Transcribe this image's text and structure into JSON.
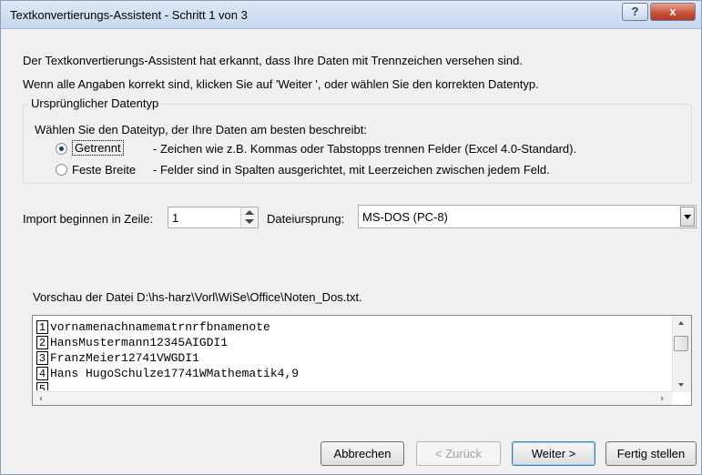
{
  "window": {
    "title": "Textkonvertierungs-Assistent - Schritt 1 von 3",
    "help_label": "?",
    "close_label": "x"
  },
  "intro": {
    "line1": "Der Textkonvertierungs-Assistent hat erkannt, dass Ihre Daten mit Trennzeichen versehen sind.",
    "line2": "Wenn alle Angaben korrekt sind, klicken Sie auf 'Weiter ', oder wählen Sie den korrekten Datentyp."
  },
  "datatype_group": {
    "title": "Ursprünglicher Datentyp",
    "prompt": "Wählen Sie den Dateityp, der Ihre Daten am besten beschreibt:",
    "options": [
      {
        "label": "Getrennt",
        "description": "- Zeichen wie z.B. Kommas oder Tabstopps trennen Felder (Excel 4.0-Standard).",
        "selected": true
      },
      {
        "label": "Feste Breite",
        "description": "- Felder sind in Spalten ausgerichtet, mit Leerzeichen zwischen jedem Feld.",
        "selected": false
      }
    ]
  },
  "import_row": {
    "label": "Import beginnen in Zeile:",
    "value": "1"
  },
  "file_origin": {
    "label": "Dateiursprung:",
    "value": "MS-DOS (PC-8)"
  },
  "preview": {
    "label": "Vorschau der Datei D:\\hs-harz\\Vorl\\WiSe\\Office\\Noten_Dos.txt.",
    "rows": [
      {
        "num": "1",
        "text": "vornamenachnamematrnrfbnamenote"
      },
      {
        "num": "2",
        "text": "HansMustermann12345AIGDI1"
      },
      {
        "num": "3",
        "text": "FranzMeier12741VWGDI1"
      },
      {
        "num": "4",
        "text": "Hans HugoSchulze17741WMathematik4,9"
      },
      {
        "num": "5",
        "text": ""
      }
    ]
  },
  "buttons": {
    "cancel": "Abbrechen",
    "back": "< Zurück",
    "next": "Weiter >",
    "finish": "Fertig stellen"
  }
}
